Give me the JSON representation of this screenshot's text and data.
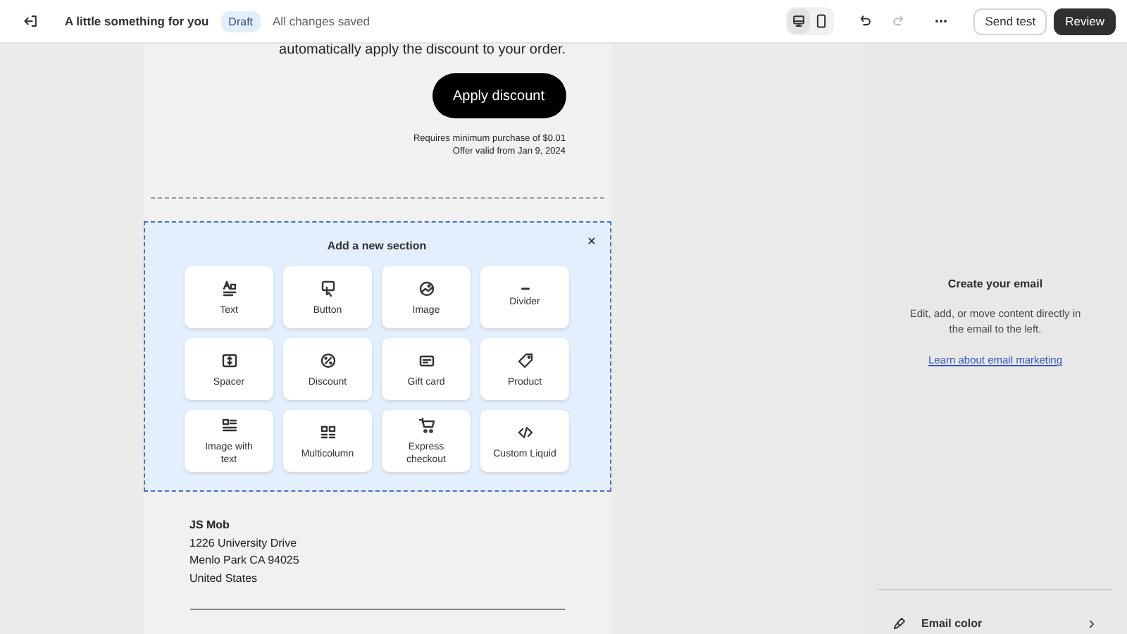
{
  "topbar": {
    "title": "A little something for you",
    "status_badge": "Draft",
    "save_state": "All changes saved",
    "view_toggle": [
      {
        "kind": "desktop",
        "selected": true
      },
      {
        "kind": "mobile",
        "selected": false
      }
    ],
    "undo": {
      "disabled": false
    },
    "redo": {
      "disabled": true
    },
    "buttons": [
      {
        "label": "Send test",
        "kind": "secondary"
      },
      {
        "label": "Review",
        "kind": "primary"
      }
    ]
  },
  "email": {
    "intro_text": "automatically apply the discount to your order.",
    "cta_button": "Apply discount",
    "fine_print": [
      "Requires minimum purchase of $0.01",
      "Offer valid from Jan 9, 2024"
    ],
    "add_section": {
      "title": "Add a new section",
      "options": [
        {
          "kind": "text",
          "label": "Text"
        },
        {
          "kind": "button",
          "label": "Button"
        },
        {
          "kind": "image",
          "label": "Image"
        },
        {
          "kind": "divider",
          "label": "Divider"
        },
        {
          "kind": "spacer",
          "label": "Spacer"
        },
        {
          "kind": "discount",
          "label": "Discount"
        },
        {
          "kind": "giftcard",
          "label": "Gift card"
        },
        {
          "kind": "product",
          "label": "Product"
        },
        {
          "kind": "imagetext",
          "label": "Image with text"
        },
        {
          "kind": "multicolumn",
          "label": "Multicolumn"
        },
        {
          "kind": "checkout",
          "label": "Express checkout"
        },
        {
          "kind": "liquid",
          "label": "Custom Liquid"
        }
      ]
    },
    "address": [
      "JS Mob",
      "1226 University Drive",
      "Menlo Park CA 94025",
      "United States"
    ]
  },
  "sidebar": {
    "heading": "Create your email",
    "description": "Edit, add, or move content directly in the email to the left.",
    "link": "Learn about email marketing",
    "settings": [
      {
        "label": "Email color"
      }
    ]
  }
}
